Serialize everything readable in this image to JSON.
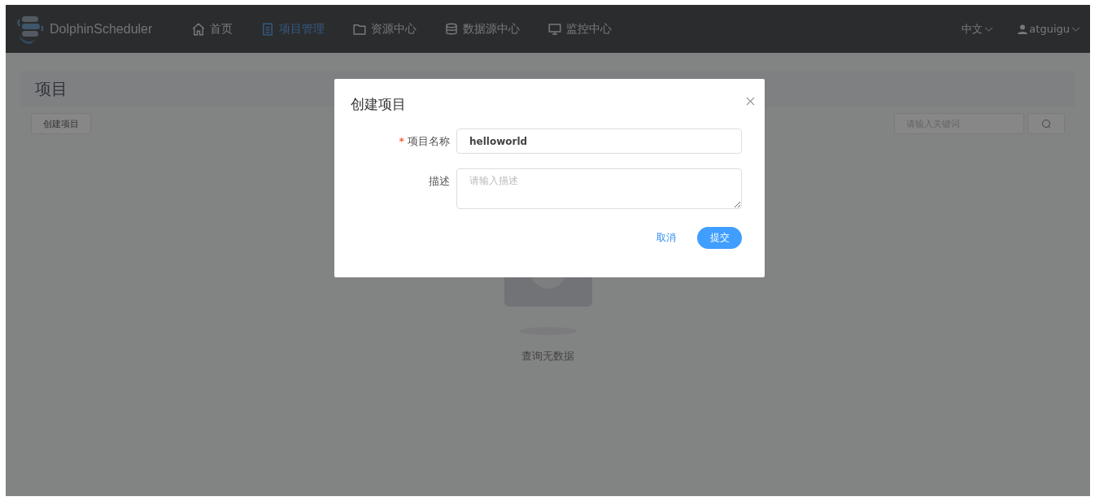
{
  "header": {
    "brand": "DolphinScheduler",
    "nav": [
      {
        "label": "首页",
        "selected": false
      },
      {
        "label": "项目管理",
        "selected": true
      },
      {
        "label": "资源中心",
        "selected": false
      },
      {
        "label": "数据源中心",
        "selected": false
      },
      {
        "label": "监控中心",
        "selected": false
      }
    ],
    "language": "中文",
    "user": "atguigu"
  },
  "page": {
    "title": "项目",
    "create_button": "创建项目",
    "search": {
      "placeholder": "请输入关键词"
    },
    "empty_text": "查询无数据"
  },
  "dialog": {
    "title": "创建项目",
    "fields": [
      {
        "label": "项目名称",
        "required_mark": "*",
        "kind": "input",
        "value": "helloworld"
      },
      {
        "label": "描述",
        "kind": "textarea",
        "placeholder": "请输入描述"
      }
    ],
    "cancel": "取消",
    "submit": "提交"
  }
}
